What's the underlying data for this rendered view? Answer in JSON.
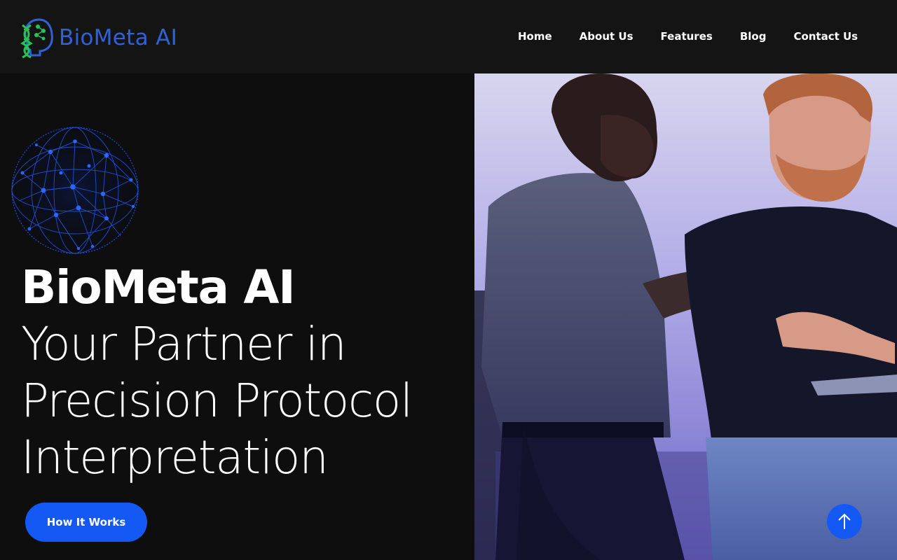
{
  "brand": {
    "name": "BioMeta AI",
    "logo_icon": "dna-head-icon",
    "color": "#2f62d8"
  },
  "nav": {
    "items": [
      {
        "label": "Home"
      },
      {
        "label": "About Us"
      },
      {
        "label": "Features"
      },
      {
        "label": "Blog"
      },
      {
        "label": "Contact Us"
      }
    ]
  },
  "hero": {
    "title_brand": "BioMeta AI",
    "title_lines": [
      "Your Partner in",
      "Precision Protocol",
      "Interpretation"
    ],
    "cta_label": "How It Works",
    "decoration_icon": "network-globe-icon",
    "image_description": "two-men-talking-photo"
  },
  "scroll_top": {
    "icon": "arrow-up-icon"
  },
  "colors": {
    "accent": "#1559f5",
    "background": "#0e0e0f",
    "header": "#141414",
    "text": "#ffffff"
  }
}
